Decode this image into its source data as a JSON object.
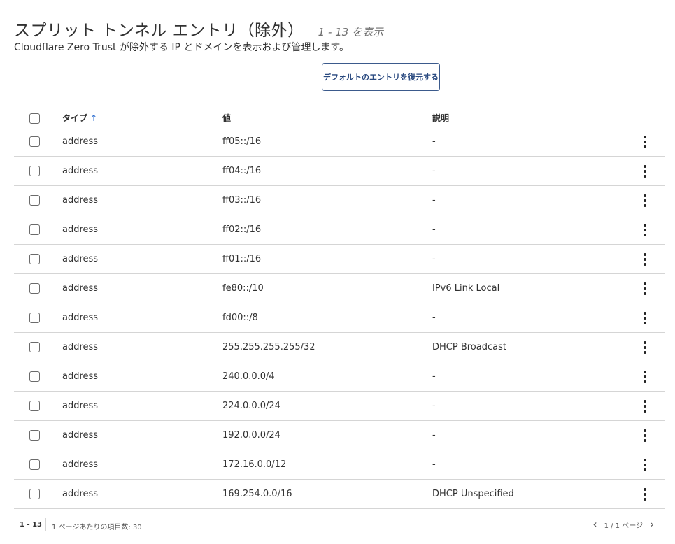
{
  "header": {
    "title": "スプリット トンネル エントリ（除外）",
    "count": "1 - 13 を表示",
    "subtitle": "Cloudflare Zero Trust が除外する IP とドメインを表示および管理します。",
    "restore_button": "デフォルトのエントリを復元する"
  },
  "table": {
    "columns": {
      "type": "タイプ",
      "value": "値",
      "description": "説明"
    },
    "sort_icon": "arrow-up-icon",
    "rows": [
      {
        "type": "address",
        "value": "ff05::/16",
        "description": "-"
      },
      {
        "type": "address",
        "value": "ff04::/16",
        "description": "-"
      },
      {
        "type": "address",
        "value": "ff03::/16",
        "description": "-"
      },
      {
        "type": "address",
        "value": "ff02::/16",
        "description": "-"
      },
      {
        "type": "address",
        "value": "ff01::/16",
        "description": "-"
      },
      {
        "type": "address",
        "value": "fe80::/10",
        "description": "IPv6 Link Local"
      },
      {
        "type": "address",
        "value": "fd00::/8",
        "description": "-"
      },
      {
        "type": "address",
        "value": "255.255.255.255/32",
        "description": "DHCP Broadcast"
      },
      {
        "type": "address",
        "value": "240.0.0.0/4",
        "description": "-"
      },
      {
        "type": "address",
        "value": "224.0.0.0/24",
        "description": "-"
      },
      {
        "type": "address",
        "value": "192.0.0.0/24",
        "description": "-"
      },
      {
        "type": "address",
        "value": "172.16.0.0/12",
        "description": "-"
      },
      {
        "type": "address",
        "value": "169.254.0.0/16",
        "description": "DHCP Unspecified"
      }
    ]
  },
  "footer": {
    "range": "1 - 13",
    "per_page": "1 ページあたりの項目数: 30",
    "page_info": "1 / 1 ページ",
    "prev_icon": "chevron-left-icon",
    "next_icon": "chevron-right-icon"
  },
  "colors": {
    "accent": "#2f6fd1",
    "button_border": "#3b5a8c",
    "text": "#313131",
    "divider": "#d5d5d5"
  }
}
